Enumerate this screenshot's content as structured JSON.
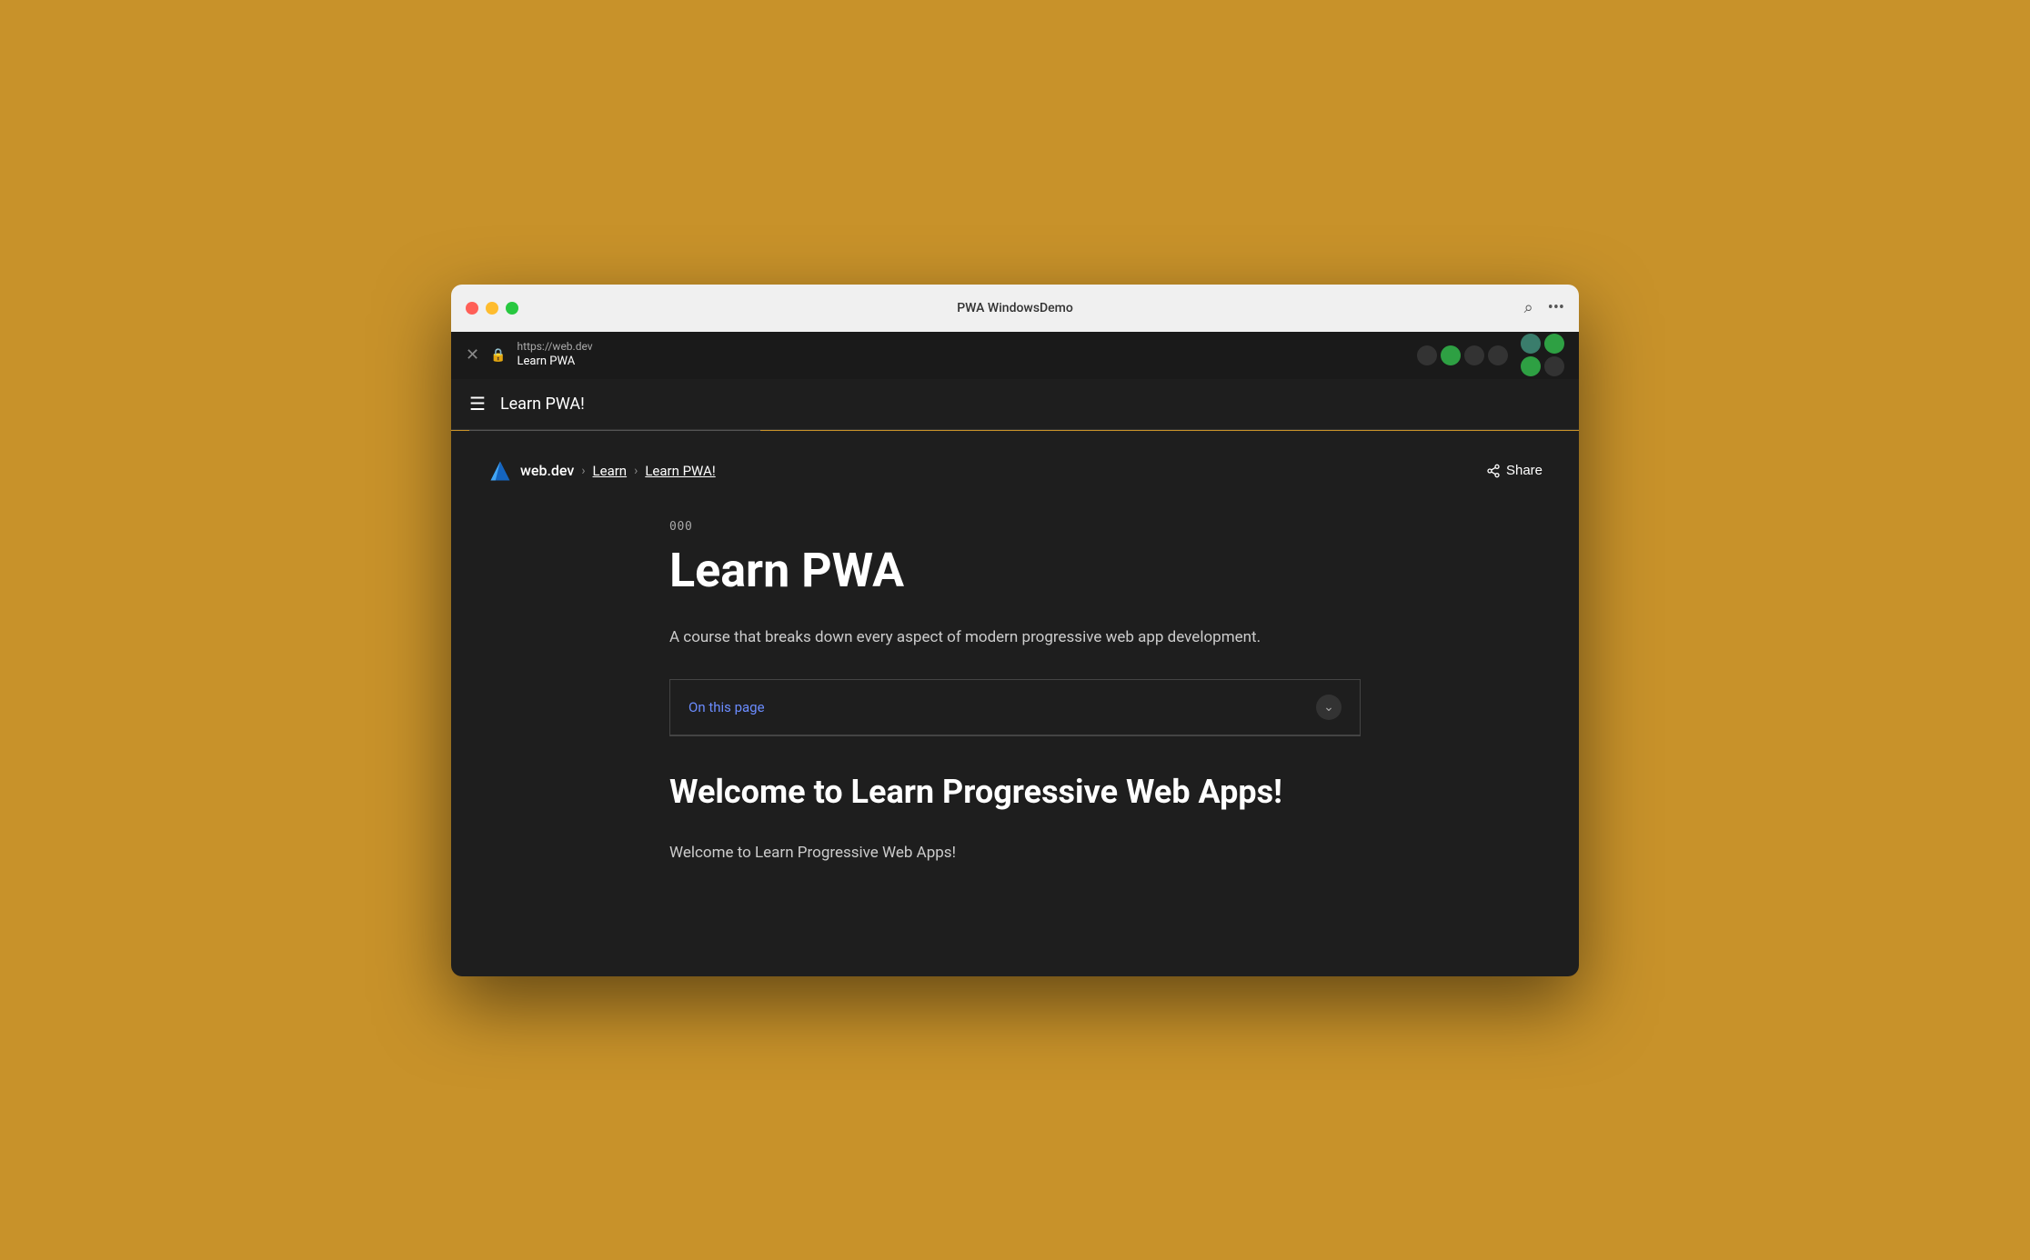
{
  "os_bg": "#C8922A",
  "window": {
    "title": "PWA WindowsDemo"
  },
  "address_bar": {
    "url": "https://web.dev",
    "site_name": "Learn PWA"
  },
  "nav": {
    "title": "Learn PWA!"
  },
  "breadcrumb": {
    "home": "web.dev",
    "parent": "Learn",
    "current": "Learn PWA!",
    "share": "Share"
  },
  "article": {
    "number": "000",
    "title": "Learn PWA",
    "description": "A course that breaks down every aspect of modern progressive web app development.",
    "on_this_page": "On this page",
    "section_heading": "Welcome to Learn Progressive Web Apps!",
    "section_text": "Welcome to Learn Progressive Web Apps!"
  },
  "icons": {
    "hamburger": "☰",
    "chevron_right": "›",
    "share_symbol": "⎋",
    "chevron_down": "⌄",
    "close": "✕",
    "lock": "🔒",
    "search": "⌕",
    "more": "···"
  }
}
